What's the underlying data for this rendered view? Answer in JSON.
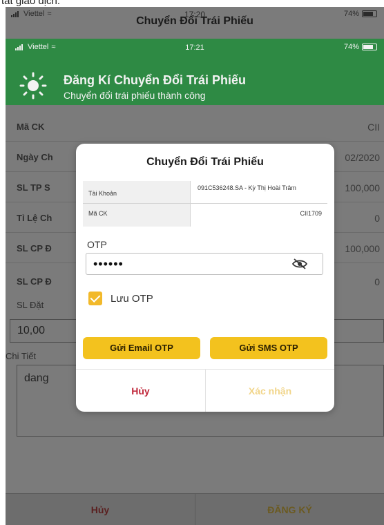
{
  "caption": "tất giao dịch.",
  "outer": {
    "carrier": "Viettel",
    "time": "17:20",
    "battery": "74%",
    "title": "Chuyển Đổi Trái Phiếu"
  },
  "inner_status": {
    "carrier": "Viettel",
    "time": "17:21",
    "battery": "74%"
  },
  "notification": {
    "title": "Đăng Kí Chuyển Đổi Trái Phiếu",
    "subtitle": "Chuyển đổi trái phiếu thành công"
  },
  "background_form": {
    "rows": [
      {
        "label": "Mã CK",
        "value": "CII"
      },
      {
        "label": "Ngày Ch",
        "value": "02/2020"
      },
      {
        "label": "SL TP S",
        "value": "100,000"
      },
      {
        "label": "Tỉ Lệ Ch",
        "value": "0"
      },
      {
        "label": "SL CP Đ",
        "value": "100,000"
      },
      {
        "label": "SL CP Đ",
        "value": "0"
      }
    ],
    "sl_dat_label": "SL Đặt",
    "sl_dat_value": "10,00",
    "chi_tiet_label": "Chi Tiết",
    "chi_tiet_value": "dang",
    "cancel_label": "Hủy",
    "register_label": "ĐĂNG KÝ"
  },
  "modal": {
    "title": "Chuyển Đổi Trái Phiếu",
    "account_label": "Tài Khoản",
    "account_value": "091C536248.SA - Kỳ Thị Hoài Trâm",
    "code_label": "Mã CK",
    "code_value": "CII1709",
    "otp_label": "OTP",
    "otp_value": "••••••",
    "save_otp_label": "Lưu OTP",
    "save_otp_checked": true,
    "email_otp_button": "Gửi Email OTP",
    "sms_otp_button": "Gửi SMS OTP",
    "cancel_button": "Hủy",
    "confirm_button": "Xác nhận"
  },
  "colors": {
    "accent_yellow": "#f3c21e",
    "header_green": "#2e8a44",
    "cancel_red": "#c0273a"
  }
}
